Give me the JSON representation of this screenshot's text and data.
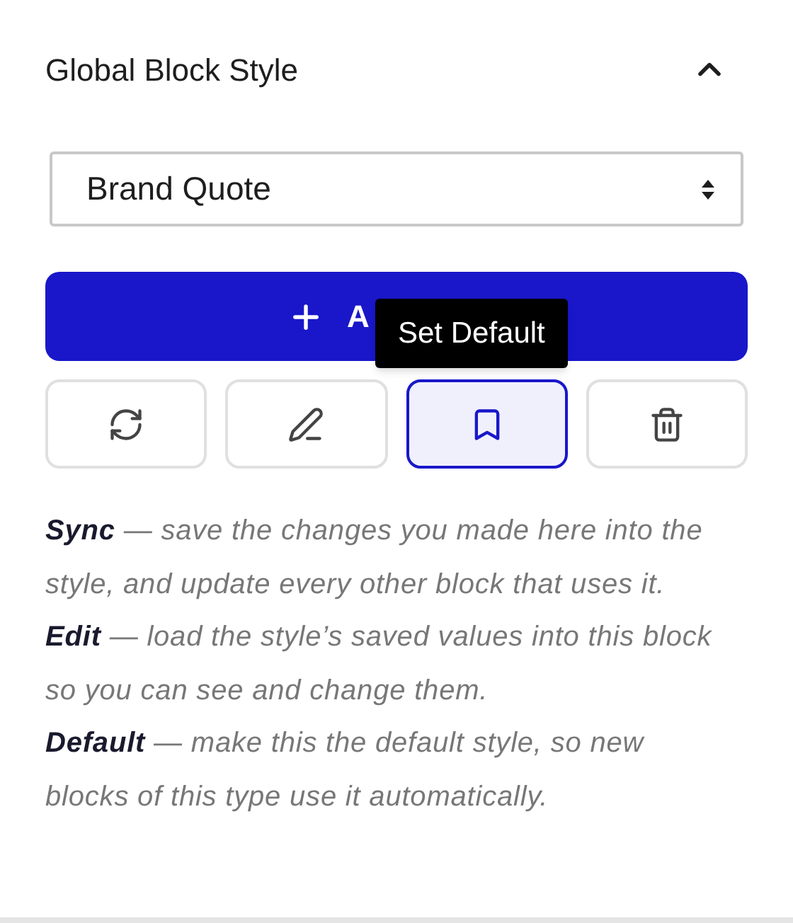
{
  "section": {
    "title": "Global Block Style",
    "expanded": true
  },
  "style_select": {
    "value": "Brand Quote"
  },
  "add_button": {
    "label": "A"
  },
  "tooltip": {
    "text": "Set Default"
  },
  "actions": [
    {
      "kind": "sync",
      "selected": false
    },
    {
      "kind": "edit",
      "selected": false
    },
    {
      "kind": "default",
      "selected": true
    },
    {
      "kind": "delete",
      "selected": false
    }
  ],
  "help": [
    "**Sync** — save the changes you made here into the style, and update every other block that uses it.",
    "**Edit** — load the style’s saved values into this block so you can see and change them.",
    "**Default** — make this the default style, so new blocks of this type use it automatically."
  ]
}
